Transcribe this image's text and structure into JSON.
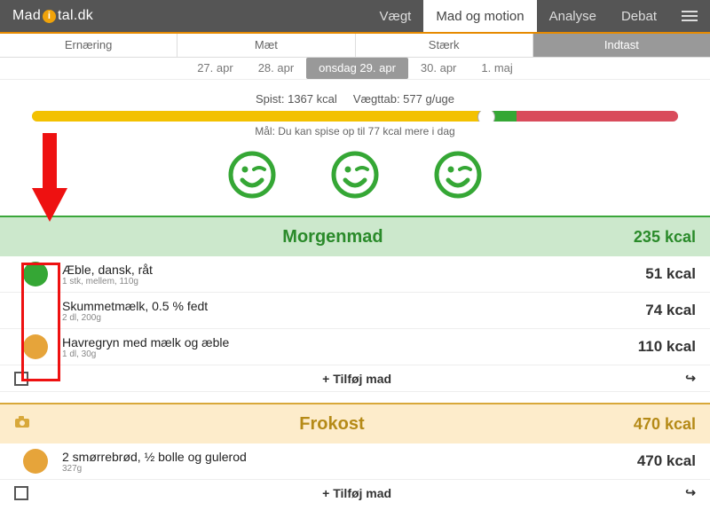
{
  "brand": {
    "pre": "Mad",
    "post": "tal.dk"
  },
  "nav": {
    "vaegt": "Vægt",
    "mad": "Mad og motion",
    "analyse": "Analyse",
    "debat": "Debat"
  },
  "tabs": {
    "ern": "Ernæring",
    "maet": "Mæt",
    "staerk": "Stærk",
    "indtast": "Indtast"
  },
  "dates": {
    "d1": "27. apr",
    "d2": "28. apr",
    "d3": "onsdag 29. apr",
    "d4": "30. apr",
    "d5": "1. maj"
  },
  "summary": {
    "spist": "Spist: 1367 kcal",
    "tab": "Vægttab: 577 g/uge"
  },
  "goal": "Mål: Du kan spise op til 77 kcal mere i dag",
  "meals": {
    "morgen": {
      "name": "Morgenmad",
      "kcal": "235 kcal"
    },
    "frokost": {
      "name": "Frokost",
      "kcal": "470 kcal"
    }
  },
  "foods": {
    "f1": {
      "name": "Æble, dansk, råt",
      "amt": "1 stk, mellem, 110g",
      "kcal": "51 kcal"
    },
    "f2": {
      "name": "Skummetmælk, 0.5 % fedt",
      "amt": "2 dl, 200g",
      "kcal": "74 kcal"
    },
    "f3": {
      "name": "Havregryn med mælk og æble",
      "amt": "1 dl, 30g",
      "kcal": "110 kcal"
    },
    "f4": {
      "name": "2 smørrebrød, ½ bolle og gulerod",
      "amt": "327g",
      "kcal": "470 kcal"
    }
  },
  "add": "Tilføj mad"
}
